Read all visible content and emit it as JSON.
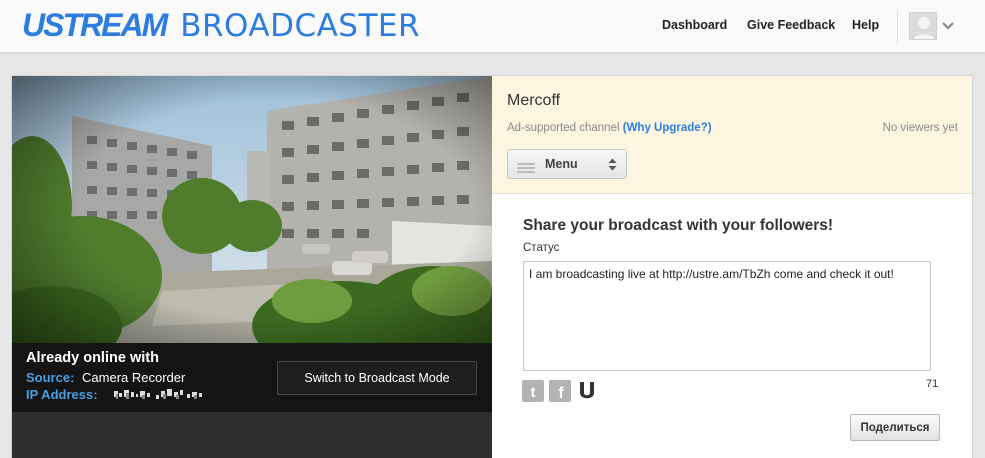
{
  "brand": {
    "logo_word": "USTREAM",
    "product": "BROADCASTER",
    "accent_color": "#2d7de0"
  },
  "nav": {
    "dashboard": "Dashboard",
    "feedback": "Give Feedback",
    "help": "Help",
    "avatar_icon": "user-avatar-icon",
    "dropdown_icon": "chevron-down-icon"
  },
  "broadcast": {
    "status_title": "Already online with",
    "source_label": "Source:",
    "source_value": "Camera Recorder",
    "ip_label": "IP Address:",
    "switch_button": "Switch to Broadcast Mode"
  },
  "channel": {
    "name": "Mercoff",
    "ad_text": "Ad-supported channel",
    "upgrade_link": "(Why Upgrade?)",
    "viewers": "No viewers yet",
    "menu_label": "Menu"
  },
  "share": {
    "title": "Share your broadcast with your followers!",
    "status_label": "Статус",
    "status_value": "I am broadcasting live at http://ustre.am/TbZh come and check it out!",
    "char_count": "71",
    "button": "Поделиться",
    "networks": [
      "twitter-icon",
      "facebook-icon",
      "ustream-icon"
    ]
  }
}
